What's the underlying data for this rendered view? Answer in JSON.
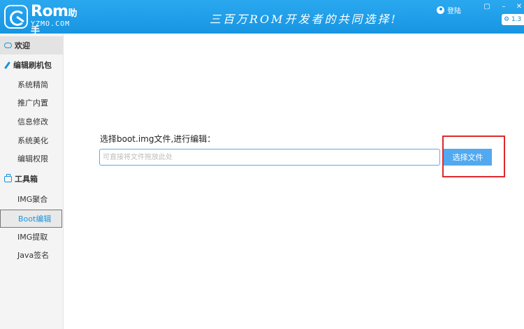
{
  "header": {
    "logo_name": "Rom",
    "logo_name_suffix": "助手",
    "logo_sub": "YZMO.COM",
    "slogan": "三百万ROM开发者的共同选择!",
    "login_label": "登陆",
    "tool_label": "1.3"
  },
  "sidebar": {
    "welcome": "欢迎",
    "edit_section": "编辑刷机包",
    "edit_items": [
      "系统精简",
      "推广内置",
      "信息修改",
      "系统美化",
      "编辑权限"
    ],
    "toolbox_section": "工具箱",
    "toolbox_items": [
      "IMG聚合",
      "Boot编辑",
      "IMG提取",
      "Java签名"
    ],
    "active_item": "Boot编辑"
  },
  "main": {
    "prompt_label": "选择boot.img文件,进行编辑：",
    "file_input_value": "",
    "file_input_placeholder": "可直接将文件拖放此处",
    "choose_file_button": "选择文件"
  },
  "colors": {
    "titlebar": "#1795e2",
    "accent": "#52a9ef",
    "highlight": "#e0292c",
    "sidebar_bg": "#f4f4f4"
  }
}
